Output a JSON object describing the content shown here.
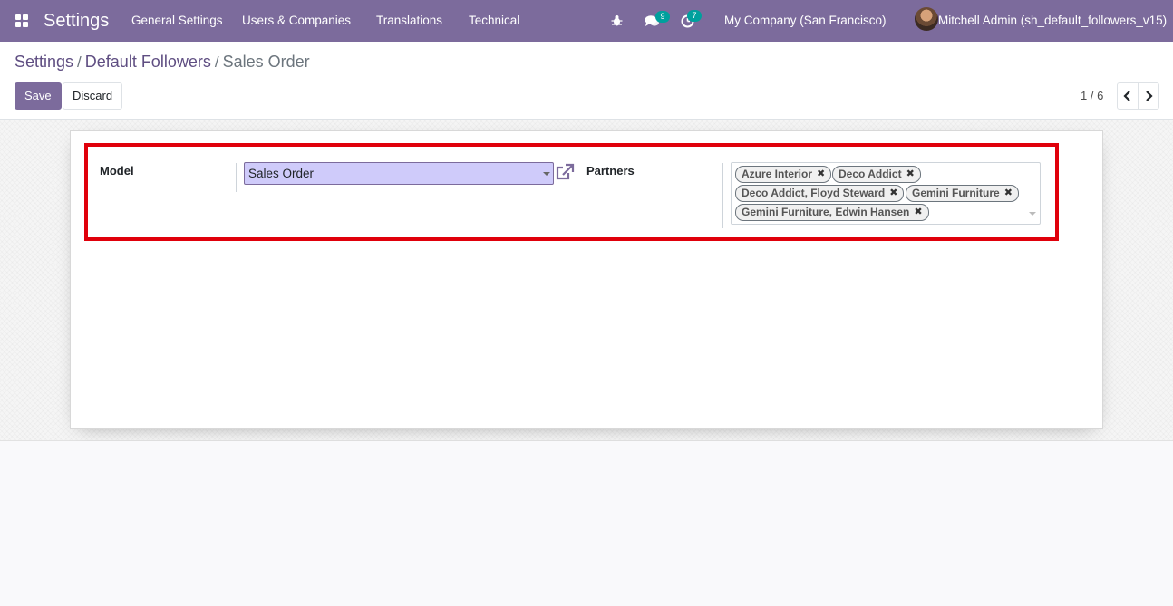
{
  "app": {
    "title": "Settings"
  },
  "navbar": {
    "menus": [
      "General Settings",
      "Users & Companies",
      "Translations",
      "Technical"
    ],
    "messages_count": "9",
    "activities_count": "7",
    "company": "My Company (San Francisco)",
    "user": "Mitchell Admin (sh_default_followers_v15)",
    "bg_color": "#7c6b9c"
  },
  "breadcrumb": {
    "items": [
      "Settings",
      "Default Followers"
    ],
    "separator": "/",
    "current": "Sales Order"
  },
  "toolbar": {
    "save_label": "Save",
    "discard_label": "Discard"
  },
  "pager": {
    "value": "1 / 6"
  },
  "form": {
    "model_label": "Model",
    "model_value": "Sales Order",
    "partners_label": "Partners",
    "partners": [
      "Azure Interior",
      "Deco Addict",
      "Deco Addict, Floyd Steward",
      "Gemini Furniture",
      "Gemini Furniture, Edwin Hansen"
    ],
    "tag_remove_glyph": "✖"
  },
  "icons": {
    "apps": "apps-grid-icon",
    "debug": "bug-icon",
    "messages": "chat-icon",
    "activities": "clock-icon",
    "external": "external-link-icon",
    "prev": "chevron-left-icon",
    "next": "chevron-right-icon"
  },
  "colors": {
    "accent": "#7c6b9c",
    "highlight_border": "#e0000b",
    "badge": "#00a09d",
    "select_bg": "#cfcbfa"
  }
}
